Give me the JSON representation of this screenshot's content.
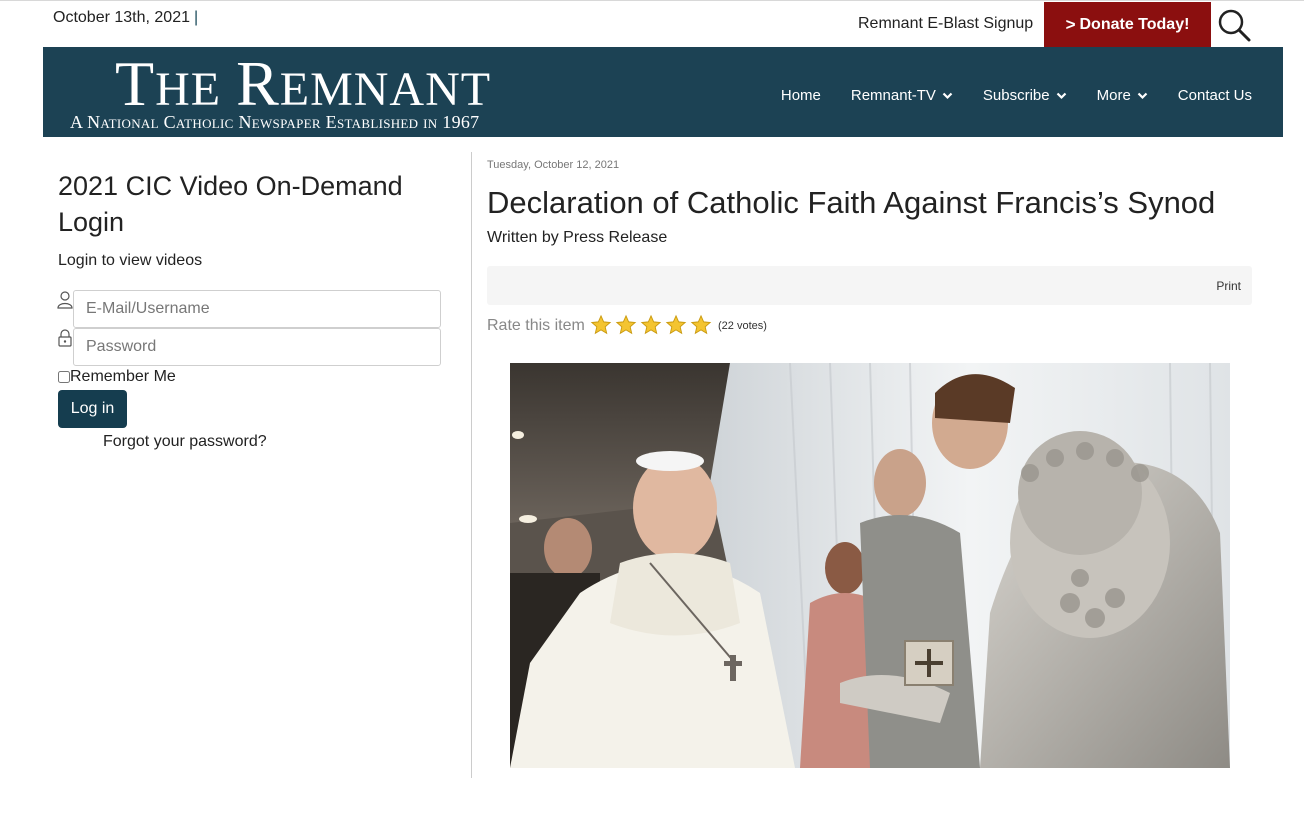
{
  "topbar": {
    "date": "October 13th, 2021",
    "separator": "|",
    "eblast_label": "Remnant E-Blast Signup",
    "donate_label": "Donate Today!",
    "donate_chevron": ">"
  },
  "brand": {
    "title_T": "T",
    "title_he": "HE",
    "title_R": "R",
    "title_emnant": "EMNANT",
    "subtitle": "A National Catholic Newspaper Established in 1967",
    "header_color": "#1c4254",
    "donate_color": "#8b0f0f"
  },
  "nav": {
    "items": [
      {
        "label": "Home",
        "has_dropdown": false
      },
      {
        "label": "Remnant-TV",
        "has_dropdown": true
      },
      {
        "label": "Subscribe",
        "has_dropdown": true
      },
      {
        "label": "More",
        "has_dropdown": true
      },
      {
        "label": "Contact Us",
        "has_dropdown": false
      }
    ],
    "caret": "⌄"
  },
  "login": {
    "title": "2021 CIC Video On-Demand Login",
    "subtitle": "Login to view videos",
    "username_placeholder": "E-Mail/Username",
    "password_placeholder": "Password",
    "remember_label": "Remember Me",
    "login_button": "Log in",
    "forgot_link": "Forgot your password?"
  },
  "article": {
    "date": "Tuesday, October 12, 2021",
    "title": "Declaration of Catholic Faith Against Francis’s Synod",
    "byline": "Written by  Press Release",
    "print_label": "Print",
    "rate_label": "Rate this item",
    "rating": 5,
    "rating_max": 5,
    "votes": "(22 votes)"
  }
}
